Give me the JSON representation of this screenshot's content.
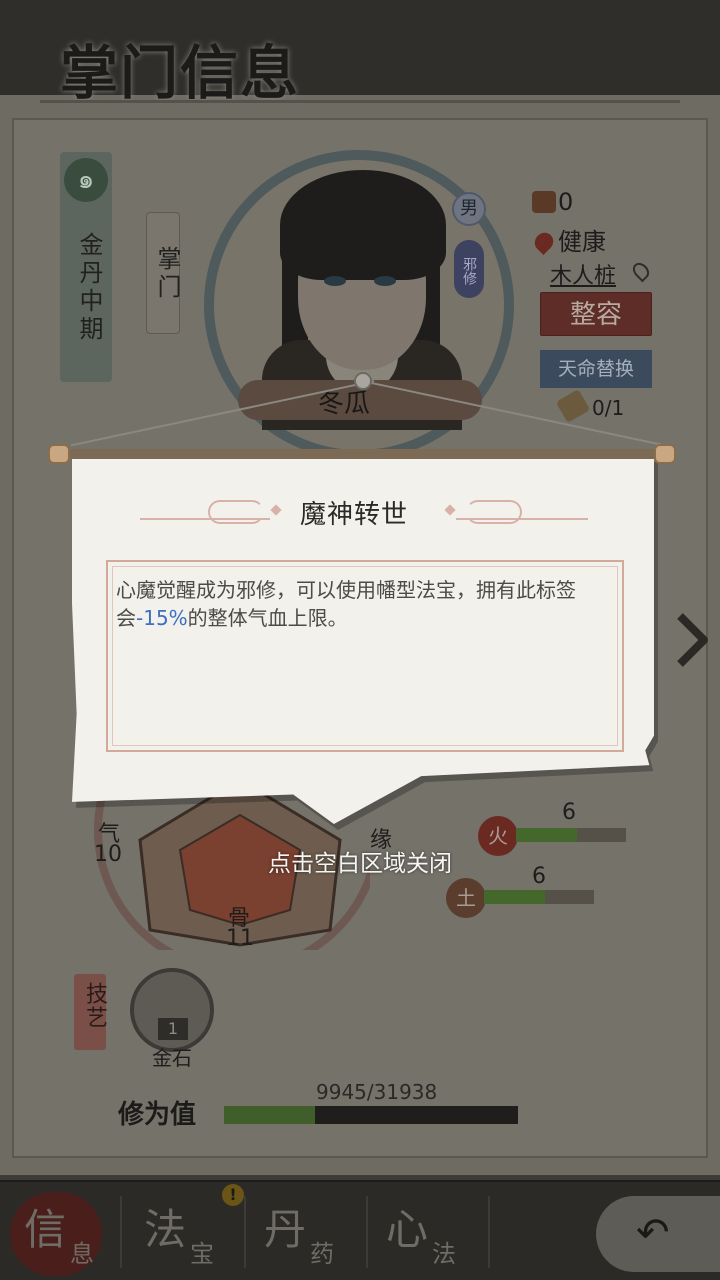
{
  "header": {
    "title": "掌门信息"
  },
  "character": {
    "realm": "金丹中期",
    "role": "掌门",
    "name": "冬瓜",
    "gender": "男",
    "path_badge": "邪修",
    "fame": "0",
    "health": "健康",
    "location": "木人桩",
    "face_button": "整容",
    "fate_button": "天命替换",
    "fate_count": "0/1"
  },
  "attributes": {
    "qi_label": "气",
    "qi_value": "10",
    "bone_label": "骨",
    "bone_value": "11",
    "fate_label": "缘",
    "fire": {
      "icon_label": "火",
      "value": "6",
      "fill": 0.55
    },
    "earth": {
      "icon_label": "土",
      "value": "6",
      "fill": 0.55
    }
  },
  "skills": {
    "label": "技艺",
    "item_name": "金石",
    "item_level": "1"
  },
  "cultivation": {
    "label": "修为值",
    "progress_text": "9945/31938",
    "progress": 0.311
  },
  "popup": {
    "title": "魔神转世",
    "desc_before": "心魔觉醒成为邪修，可以使用幡型法宝，拥有此标签会",
    "desc_highlight": "-15%",
    "desc_after": "的整体气血上限。",
    "close_hint": "点击空白区域关闭",
    "highlight_color": "#3d6fc2"
  },
  "nav": {
    "items": [
      {
        "big": "信",
        "small": "息",
        "active": true
      },
      {
        "big": "法",
        "small": "宝",
        "alert": "!"
      },
      {
        "big": "丹",
        "small": "药"
      },
      {
        "big": "心",
        "small": "法"
      }
    ]
  }
}
